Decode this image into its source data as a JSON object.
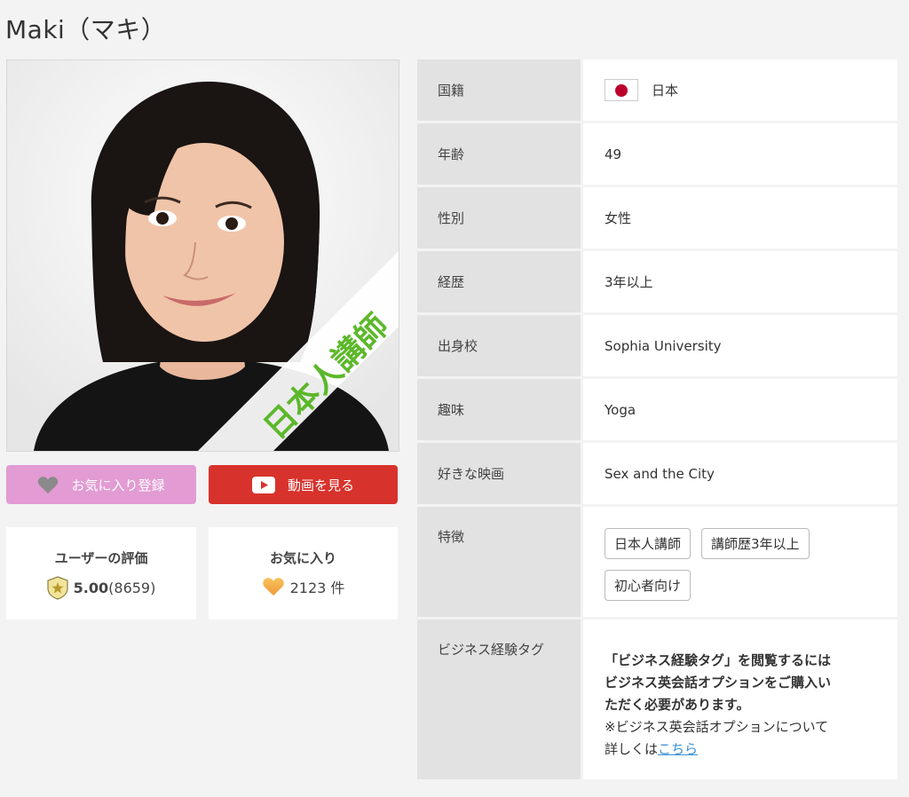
{
  "page_title": "Maki（マキ）",
  "photo": {
    "badge_text": "日本人講師",
    "badge_color": "#5cb82a"
  },
  "buttons": {
    "favorite_label": "お気に入り登録",
    "video_label": "動画を見る",
    "favorite_icon": "heart-icon",
    "video_icon": "play-icon"
  },
  "stats": {
    "rating_label": "ユーザーの評価",
    "rating_value": "5.00",
    "rating_count": "(8659)",
    "favorites_label": "お気に入り",
    "favorites_value": "2123 件"
  },
  "profile": {
    "nationality_label": "国籍",
    "nationality_value": "日本",
    "age_label": "年齢",
    "age_value": "49",
    "gender_label": "性別",
    "gender_value": "女性",
    "experience_label": "経歴",
    "experience_value": "3年以上",
    "school_label": "出身校",
    "school_value": "Sophia University",
    "hobby_label": "趣味",
    "hobby_value": "Yoga",
    "movie_label": "好きな映画",
    "movie_value": "Sex and the City",
    "features_label": "特徴",
    "features": [
      "日本人講師",
      "講師歴3年以上",
      "初心者向け"
    ],
    "business_label": "ビジネス経験タグ",
    "business_notice_line1": "「ビジネス経験タグ」を閲覧するには",
    "business_notice_line2": "ビジネス英会話オプションをご購入い",
    "business_notice_line3": "ただく必要があります。",
    "business_info_line1": "※ビジネス英会話オプションについて",
    "business_info_line2": "詳しくは",
    "business_link": "こちら"
  }
}
